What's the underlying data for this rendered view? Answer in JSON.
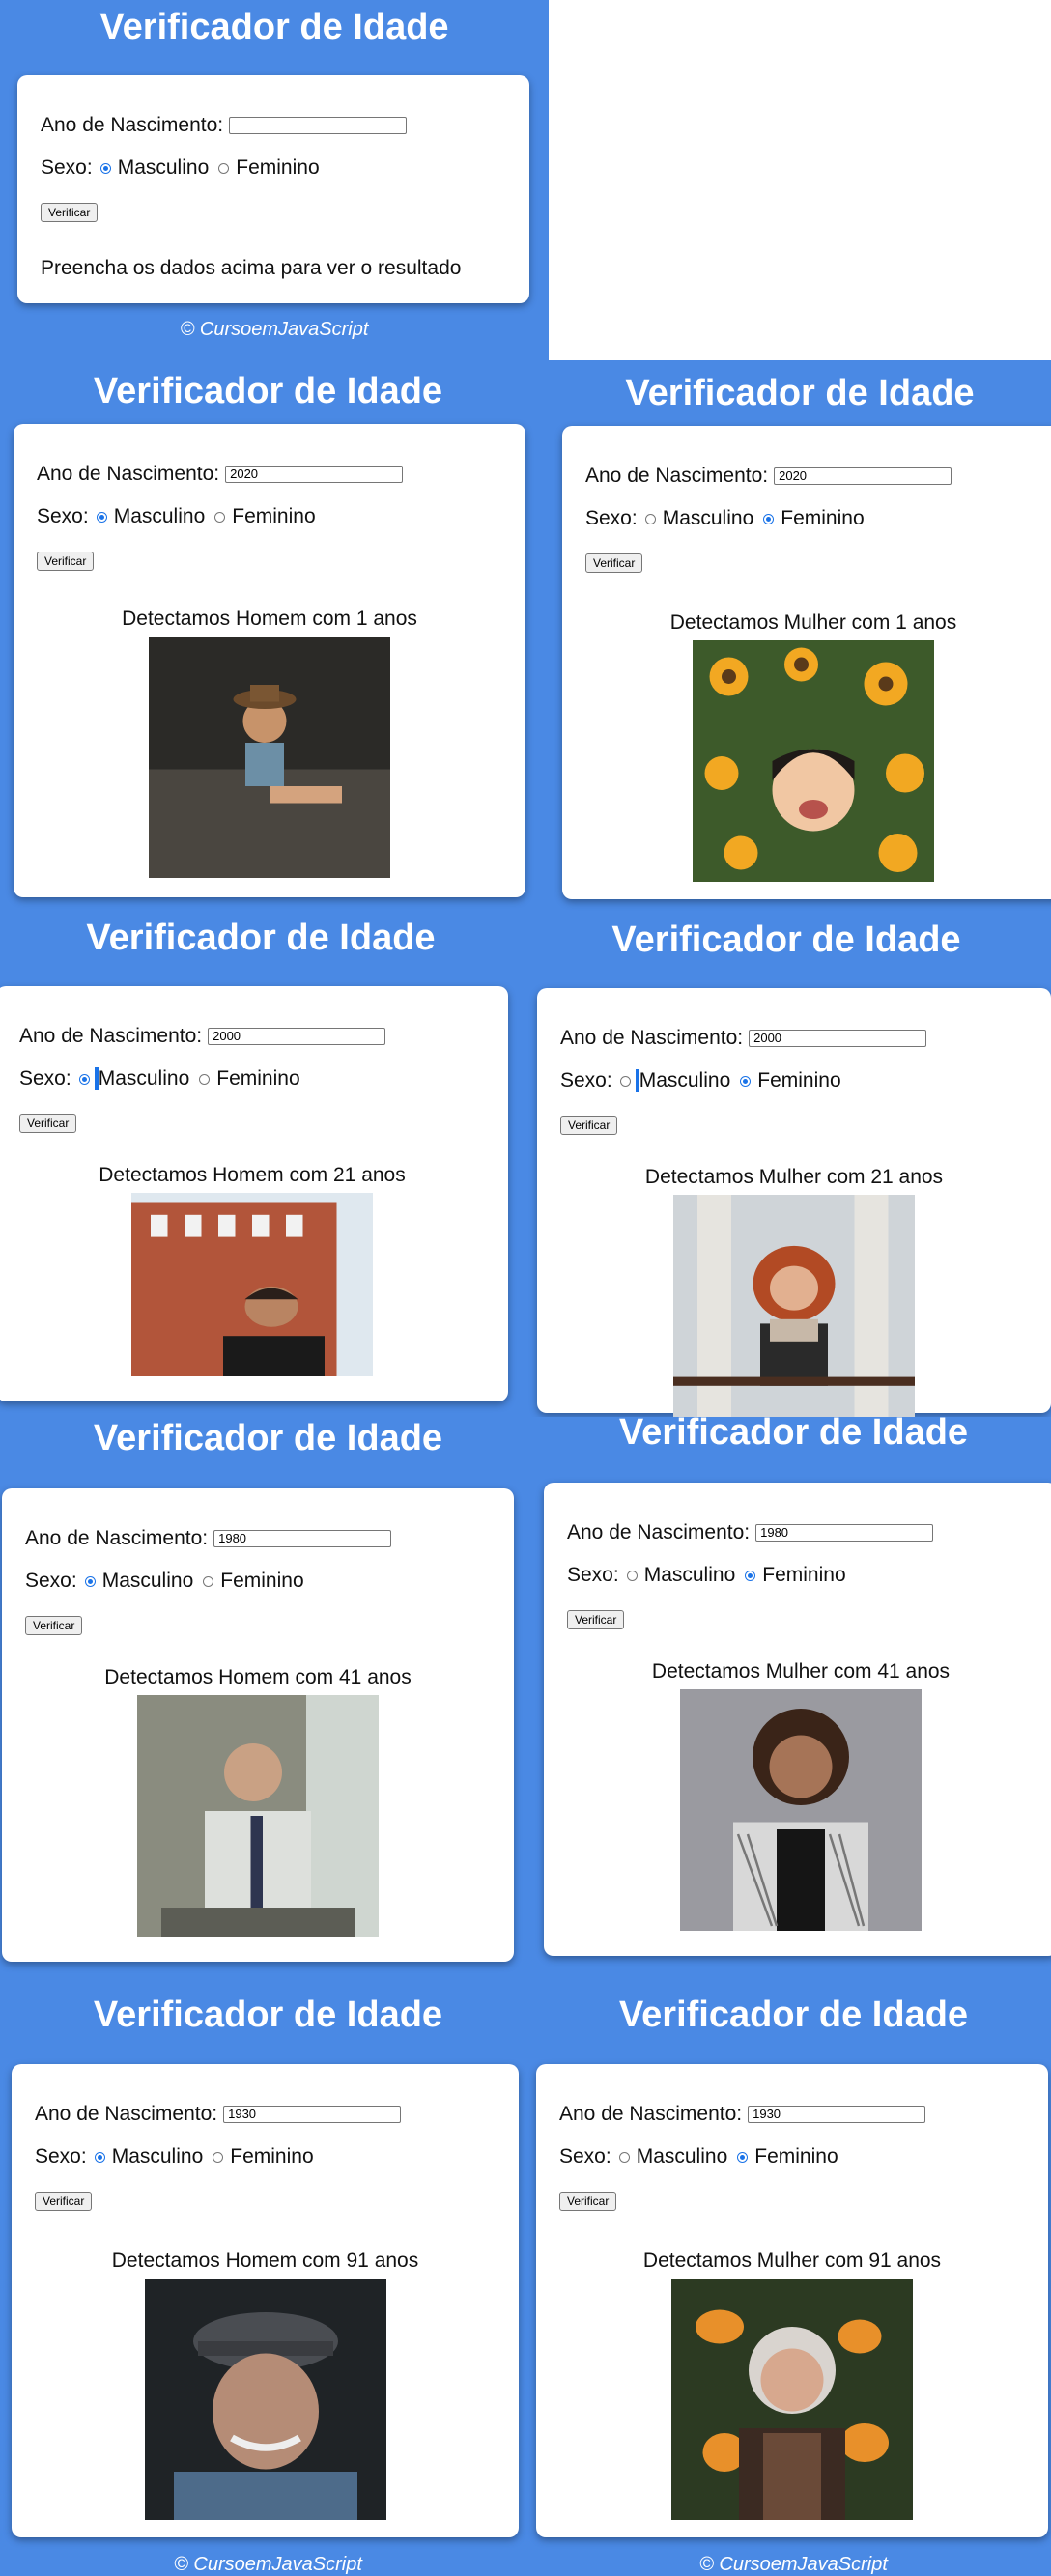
{
  "app": {
    "title": "Verificador de Idade",
    "birth_label": "Ano de Nascimento:",
    "sex_label": "Sexo:",
    "male_label": "Masculino",
    "female_label": "Feminino",
    "verify_button": "Verificar",
    "footer": "© CursoemJavaScript"
  },
  "initial": {
    "birth_value": "",
    "selected_sex": "Masculino",
    "prompt": "Preencha os dados acima para ver o resultado"
  },
  "panels": [
    {
      "birth_value": "2020",
      "selected_sex": "Masculino",
      "result": "Detectamos Homem com 1 anos",
      "photo": "baby-boy-photo"
    },
    {
      "birth_value": "2020",
      "selected_sex": "Feminino",
      "result": "Detectamos Mulher com 1 anos",
      "photo": "baby-girl-photo"
    },
    {
      "birth_value": "2000",
      "selected_sex": "Masculino",
      "result": "Detectamos Homem com 21 anos",
      "photo": "young-man-photo"
    },
    {
      "birth_value": "2000",
      "selected_sex": "Feminino",
      "result": "Detectamos Mulher com 21 anos",
      "photo": "young-woman-photo"
    },
    {
      "birth_value": "1980",
      "selected_sex": "Masculino",
      "result": "Detectamos Homem com 41 anos",
      "photo": "adult-man-photo"
    },
    {
      "birth_value": "1980",
      "selected_sex": "Feminino",
      "result": "Detectamos Mulher com 41 anos",
      "photo": "adult-woman-photo"
    },
    {
      "birth_value": "1930",
      "selected_sex": "Masculino",
      "result": "Detectamos Homem com 91 anos",
      "photo": "elderly-man-photo"
    },
    {
      "birth_value": "1930",
      "selected_sex": "Feminino",
      "result": "Detectamos Mulher com 91 anos",
      "photo": "elderly-woman-photo"
    }
  ],
  "colors": {
    "background": "#4a89e4",
    "card": "#ffffff",
    "radio_checked": "#1a73e8"
  }
}
